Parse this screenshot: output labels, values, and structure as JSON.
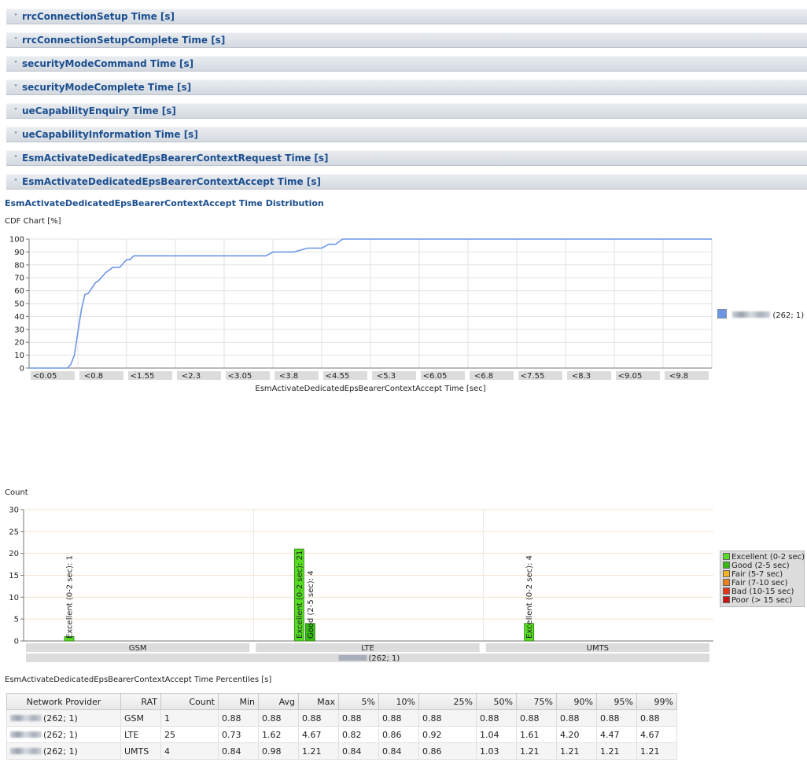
{
  "panels": [
    {
      "label": "rrcConnectionSetup Time [s]",
      "state": "collapsed"
    },
    {
      "label": "rrcConnectionSetupComplete Time [s]",
      "state": "collapsed"
    },
    {
      "label": "securityModeCommand Time [s]",
      "state": "collapsed"
    },
    {
      "label": "securityModeComplete Time [s]",
      "state": "collapsed"
    },
    {
      "label": "ueCapabilityEnquiry Time [s]",
      "state": "collapsed"
    },
    {
      "label": "ueCapabilityInformation Time [s]",
      "state": "collapsed"
    },
    {
      "label": "EsmActivateDedicatedEpsBearerContextRequest Time [s]",
      "state": "collapsed"
    },
    {
      "label": "EsmActivateDedicatedEpsBearerContextAccept Time [s]",
      "state": "expanded"
    }
  ],
  "icons": {
    "collapsed": "chevron-double-down-icon",
    "expanded": "chevron-double-up-icon"
  },
  "distribution_title": "EsmActivateDedicatedEpsBearerContextAccept Time Distribution",
  "cdf_label": "CDF Chart [%]",
  "count_label": "Count",
  "percentiles_title": "EsmActivateDedicatedEpsBearerContextAccept Time Percentiles [s]",
  "legend1": {
    "label": "(262; 1)",
    "color": "#6e96e6"
  },
  "chart_data": [
    {
      "type": "line",
      "title": "",
      "xlabel": "EsmActivateDedicatedEpsBearerContextAccept Time [sec]",
      "ylabel": "CDF Chart [%]",
      "ylim": [
        0,
        100
      ],
      "yticks": [
        0,
        10,
        20,
        30,
        40,
        50,
        60,
        70,
        80,
        90,
        100
      ],
      "categories": [
        "<0.05",
        "<0.8",
        "<1.55",
        "<2.3",
        "<3.05",
        "<3.8",
        "<4.55",
        "<5.3",
        "<6.05",
        "<6.8",
        "<7.55",
        "<8.3",
        "<9.05",
        "<9.8"
      ],
      "x": [
        0,
        0.55,
        0.6,
        0.65,
        0.7,
        0.75,
        0.8,
        0.85,
        0.9,
        0.95,
        1.0,
        1.1,
        1.2,
        1.3,
        1.4,
        1.45,
        1.5,
        1.6,
        1.7,
        2.0,
        2.5,
        3.0,
        3.4,
        3.5,
        3.6,
        3.8,
        4.0,
        4.1,
        4.2,
        4.3,
        4.4,
        4.5,
        4.7,
        5.0,
        6.0,
        7.0,
        8.0,
        9.0,
        9.8
      ],
      "series": [
        {
          "name": "(262; 1)",
          "color": "#6e96e6",
          "values": [
            0,
            0,
            3,
            10,
            28,
            45,
            57,
            58,
            62,
            66,
            68,
            74,
            78,
            78,
            84,
            84,
            87,
            87,
            87,
            87,
            87,
            87,
            87,
            90,
            90,
            90,
            93,
            93,
            93,
            96,
            96,
            100,
            100,
            100,
            100,
            100,
            100,
            100,
            100
          ]
        }
      ],
      "grid": true,
      "legend": "right"
    },
    {
      "type": "bar",
      "title": "",
      "ylabel": "Count",
      "ylim": [
        0,
        30
      ],
      "yticks": [
        0,
        5,
        10,
        15,
        20,
        25,
        30
      ],
      "categories": [
        "GSM",
        "LTE",
        "UMTS"
      ],
      "group_label": "(262; 1)",
      "series": [
        {
          "name": "Excellent (0-2 sec)",
          "color": "#55dd22",
          "values": [
            1,
            21,
            4
          ]
        },
        {
          "name": "Good (2-5 sec)",
          "color": "#33bb11",
          "values": [
            0,
            4,
            0
          ]
        },
        {
          "name": "Fair (5-7 sec)",
          "color": "#f5b120",
          "values": [
            0,
            0,
            0
          ]
        },
        {
          "name": "Fair (7-10 sec)",
          "color": "#f07f1a",
          "values": [
            0,
            0,
            0
          ]
        },
        {
          "name": "Bad (10-15 sec)",
          "color": "#e8331a",
          "values": [
            0,
            0,
            0
          ]
        },
        {
          "name": "Poor (> 15 sec)",
          "color": "#cc1111",
          "values": [
            0,
            0,
            0
          ]
        }
      ],
      "data_labels": [
        {
          "category": "GSM",
          "text": "Excellent (0-2 sec): 1"
        },
        {
          "category": "LTE",
          "text": "Excellent (0-2 sec): 21"
        },
        {
          "category": "LTE",
          "text": "Good (2-5 sec): 4"
        },
        {
          "category": "UMTS",
          "text": "Excellent (0-2 sec): 4"
        }
      ],
      "grid": true,
      "legend": "right"
    }
  ],
  "table": {
    "columns": [
      "Network Provider",
      "RAT",
      "Count",
      "Min",
      "Avg",
      "Max",
      "5%",
      "10%",
      "25%",
      "50%",
      "75%",
      "90%",
      "95%",
      "99%"
    ],
    "rows": [
      [
        "(262; 1)",
        "GSM",
        "1",
        "0.88",
        "0.88",
        "0.88",
        "0.88",
        "0.88",
        "0.88",
        "0.88",
        "0.88",
        "0.88",
        "0.88",
        "0.88"
      ],
      [
        "(262; 1)",
        "LTE",
        "25",
        "0.73",
        "1.62",
        "4.67",
        "0.82",
        "0.86",
        "0.92",
        "1.04",
        "1.61",
        "4.20",
        "4.47",
        "4.67"
      ],
      [
        "(262; 1)",
        "UMTS",
        "4",
        "0.84",
        "0.98",
        "1.21",
        "0.84",
        "0.84",
        "0.86",
        "1.03",
        "1.21",
        "1.21",
        "1.21",
        "1.21"
      ]
    ]
  }
}
